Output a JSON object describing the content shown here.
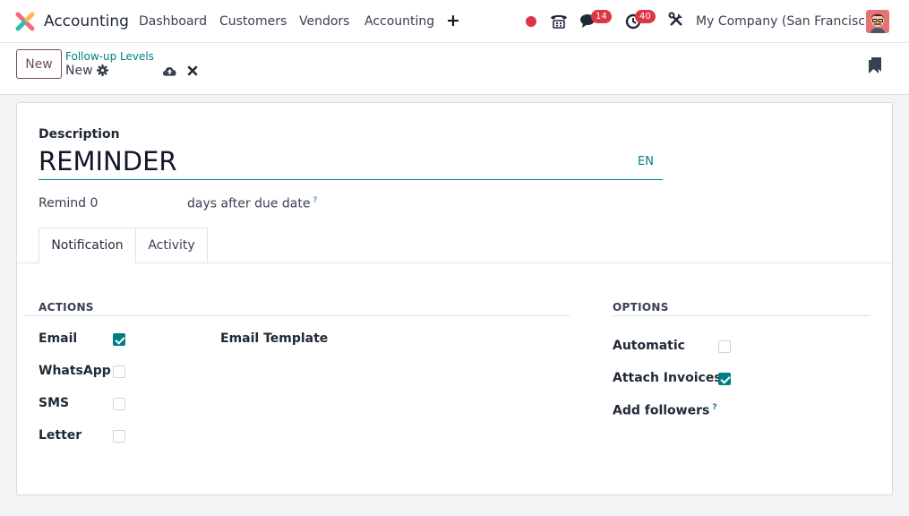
{
  "navbar": {
    "app_name": "Accounting",
    "menu": [
      "Dashboard",
      "Customers",
      "Vendors",
      "Accounting"
    ],
    "messages_count": "14",
    "activities_count": "40",
    "company": "My Company (San Francisco)"
  },
  "control_panel": {
    "new_label": "New",
    "breadcrumb": "Follow-up Levels",
    "record_name": "New"
  },
  "form": {
    "description_label": "Description",
    "description_value": "REMINDER",
    "lang": "EN",
    "remind_text": "Remind 0",
    "days_text": "days after due date",
    "help_mark": "?",
    "tabs": [
      "Notification",
      "Activity"
    ],
    "actions_title": "ACTIONS",
    "options_title": "OPTIONS",
    "actions": [
      {
        "label": "Email",
        "checked": true
      },
      {
        "label": "WhatsApp",
        "checked": false
      },
      {
        "label": "SMS",
        "checked": false
      },
      {
        "label": "Letter",
        "checked": false
      }
    ],
    "email_template_label": "Email Template",
    "options": [
      {
        "label": "Automatic",
        "checked": false
      },
      {
        "label": "Attach Invoices",
        "checked": true
      },
      {
        "label": "Add followers",
        "checked": null
      }
    ]
  },
  "colors": {
    "accent": "#017e84",
    "brand": "#714b67",
    "badge": "#dc3545"
  }
}
